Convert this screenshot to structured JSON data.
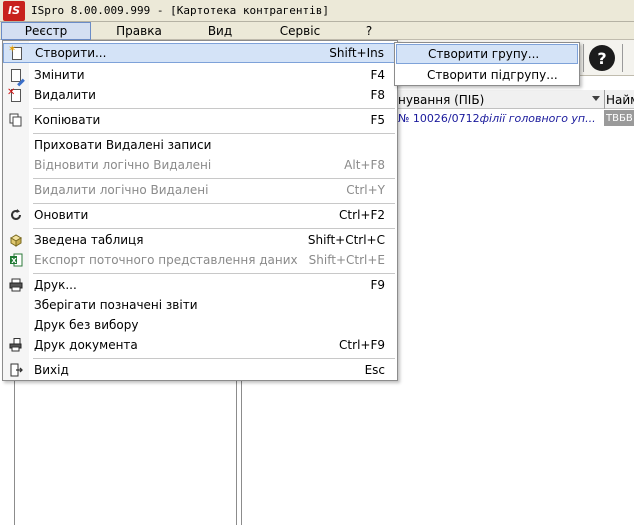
{
  "window": {
    "logo_text": "IS",
    "title": "ISpro 8.00.009.999 - [Картотека контрагентів]"
  },
  "menubar": {
    "items": [
      {
        "label": "Реєстр"
      },
      {
        "label": "Правка"
      },
      {
        "label": "Вид"
      },
      {
        "label": "Сервіс"
      },
      {
        "label": "?"
      }
    ]
  },
  "toolbar": {
    "help_glyph": "?"
  },
  "grid": {
    "columns": [
      {
        "label": "нування (ПІБ)"
      },
      {
        "label": "Наймен"
      }
    ],
    "rows": [
      {
        "c1_prefix": "№ 10026/0712 ",
        "c1_italic": "філії головного уп...",
        "c2": "ТВБВ"
      }
    ]
  },
  "dropdown": {
    "items": [
      {
        "label": "Створити...",
        "shortcut": "Shift+Ins",
        "icon": "new-doc-icon"
      },
      {
        "label": "Змінити",
        "shortcut": "F4",
        "icon": "edit-doc-icon"
      },
      {
        "label": "Видалити",
        "shortcut": "F8",
        "icon": "delete-doc-icon"
      },
      {
        "label": "Копіювати",
        "shortcut": "F5",
        "icon": "copy-icon"
      },
      {
        "label": "Приховати Видалені записи",
        "shortcut": "",
        "icon": ""
      },
      {
        "label": "Відновити логічно Видалені",
        "shortcut": "Alt+F8",
        "icon": ""
      },
      {
        "label": "Видалити логічно Видалені",
        "shortcut": "Ctrl+Y",
        "icon": ""
      },
      {
        "label": "Оновити",
        "shortcut": "Ctrl+F2",
        "icon": "refresh-icon"
      },
      {
        "label": "Зведена таблиця",
        "shortcut": "Shift+Ctrl+C",
        "icon": "pivot-table-icon"
      },
      {
        "label": "Експорт поточного представлення даних",
        "shortcut": "Shift+Ctrl+E",
        "icon": "excel-export-icon"
      },
      {
        "label": "Друк...",
        "shortcut": "F9",
        "icon": "printer-icon"
      },
      {
        "label": "Зберігати позначені звіти",
        "shortcut": "",
        "icon": ""
      },
      {
        "label": "Друк без вибору",
        "shortcut": "",
        "icon": ""
      },
      {
        "label": "Друк документа",
        "shortcut": "Ctrl+F9",
        "icon": "print-document-icon"
      },
      {
        "label": "Вихід",
        "shortcut": "Esc",
        "icon": "exit-icon"
      }
    ]
  },
  "submenu": {
    "items": [
      {
        "label": "Створити групу..."
      },
      {
        "label": "Створити підгрупу..."
      }
    ]
  }
}
